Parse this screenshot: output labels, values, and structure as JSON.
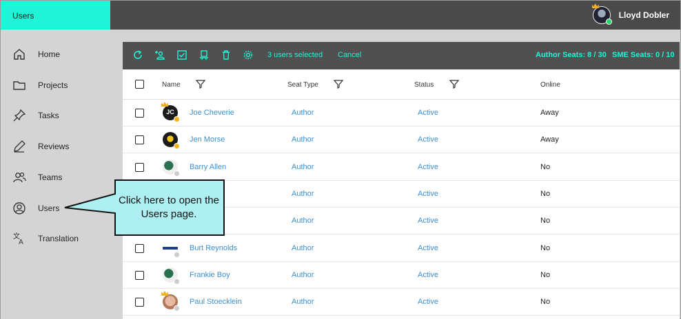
{
  "app": {
    "brand": "Users"
  },
  "user": {
    "name": "Lloyd Dobler"
  },
  "sidebar": {
    "items": [
      {
        "label": "Home",
        "icon": "home-icon"
      },
      {
        "label": "Projects",
        "icon": "folder-icon"
      },
      {
        "label": "Tasks",
        "icon": "pin-icon"
      },
      {
        "label": "Reviews",
        "icon": "pen-icon"
      },
      {
        "label": "Teams",
        "icon": "teams-icon"
      },
      {
        "label": "Users",
        "icon": "user-icon"
      },
      {
        "label": "Translation",
        "icon": "translate-icon"
      }
    ]
  },
  "toolbar": {
    "selected_text": "3 users selected",
    "cancel_label": "Cancel",
    "author_seats": "Author Seats: 8 / 30",
    "sme_seats": "SME Seats: 0 / 10"
  },
  "table": {
    "headers": {
      "name": "Name",
      "seat_type": "Seat Type",
      "status": "Status",
      "online": "Online"
    },
    "rows": [
      {
        "name": "Joe Cheverie",
        "seat": "Author",
        "status": "Active",
        "online": "Away",
        "avatar": "JC",
        "presence": "away",
        "crown": true
      },
      {
        "name": "Jen Morse",
        "seat": "Author",
        "status": "Active",
        "online": "Away",
        "avatar": "",
        "presence": "away",
        "crown": false
      },
      {
        "name": "Barry Allen",
        "seat": "Author",
        "status": "Active",
        "online": "No",
        "avatar": "",
        "presence": "offline",
        "crown": false
      },
      {
        "name": "er",
        "seat": "Author",
        "status": "Active",
        "online": "No",
        "avatar": "",
        "presence": "offline",
        "crown": false
      },
      {
        "name": "erson",
        "seat": "Author",
        "status": "Active",
        "online": "No",
        "avatar": "",
        "presence": "offline",
        "crown": false
      },
      {
        "name": "Burt Reynolds",
        "seat": "Author",
        "status": "Active",
        "online": "No",
        "avatar": "",
        "presence": "offline",
        "crown": false
      },
      {
        "name": "Frankie Boy",
        "seat": "Author",
        "status": "Active",
        "online": "No",
        "avatar": "",
        "presence": "offline",
        "crown": false
      },
      {
        "name": "Paul Stoecklein",
        "seat": "Author",
        "status": "Active",
        "online": "No",
        "avatar": "",
        "presence": "offline",
        "crown": true
      }
    ]
  },
  "callout": {
    "text": "Click here to open the Users page."
  },
  "colors": {
    "accent": "#1ff5d6",
    "link": "#3c8fd1",
    "away": "#f5b316",
    "offline": "#cccccc",
    "online": "#29d36b"
  }
}
